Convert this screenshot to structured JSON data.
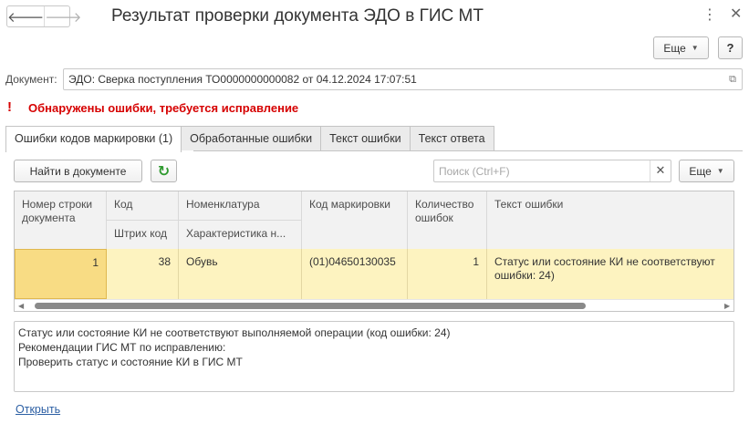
{
  "window": {
    "title": "Результат проверки документа ЭДО в ГИС МТ",
    "back_glyph": "🡐",
    "forward_glyph": "🡒",
    "menu_glyph": "⋮",
    "close_glyph": "✕"
  },
  "top_toolbar": {
    "more_label": "Еще",
    "help_label": "?"
  },
  "document": {
    "label": "Документ:",
    "value": "ЭДО: Сверка поступления ТО0000000000082 от 04.12.2024 17:07:51"
  },
  "error_banner": {
    "icon": "!",
    "text": "Обнаружены ошибки, требуется исправление"
  },
  "tabs": [
    {
      "label": "Ошибки кодов маркировки (1)",
      "active": true
    },
    {
      "label": "Обработанные ошибки",
      "active": false
    },
    {
      "label": "Текст ошибки",
      "active": false
    },
    {
      "label": "Текст ответа",
      "active": false
    }
  ],
  "table_toolbar": {
    "find_label": "Найти в документе",
    "search_placeholder": "Поиск (Ctrl+F)",
    "more_label": "Еще"
  },
  "table": {
    "headers": {
      "row_number": "Номер строки документа",
      "code": "Код",
      "barcode": "Штрих код",
      "nomenclature": "Номенклатура",
      "characteristic": "Характеристика н...",
      "marking_code": "Код маркировки",
      "error_count": "Количество ошибок",
      "error_text": "Текст ошибки"
    },
    "rows": [
      {
        "row_number": "1",
        "code": "38",
        "nomenclature": "Обувь",
        "marking_code": "(01)04650130035",
        "error_count": "1",
        "error_text": "Статус или состояние КИ не соответствуют ошибки: 24)"
      }
    ]
  },
  "message": {
    "lines": [
      "Статус или состояние КИ не соответствуют выполняемой операции (код ошибки: 24)",
      "Рекомендации ГИС МТ по исправлению:",
      "Проверить статус и состояние КИ в ГИС МТ"
    ]
  },
  "footer": {
    "open_link": "Открыть"
  }
}
